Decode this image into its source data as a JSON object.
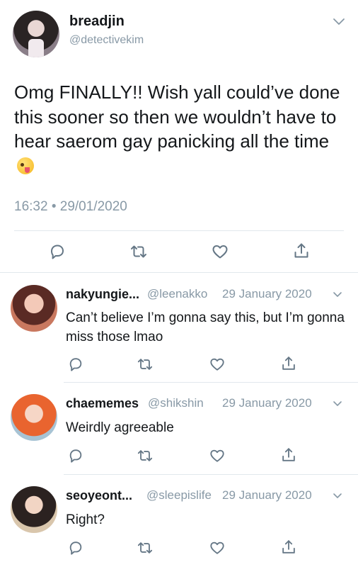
{
  "main_tweet": {
    "display_name": "breadjin",
    "handle": "@detectivekim",
    "text": "Omg FINALLY!! Wish yall could’ve done this sooner so then we wouldn’t have to hear saerom gay panicking all the time",
    "timestamp": "16:32 • 29/01/2020",
    "emoji": "zany-face-emoji"
  },
  "replies": [
    {
      "display_name": "nakyungie...",
      "handle": "@leenakko",
      "date": "29 January 2020",
      "text": "Can’t believe I’m gonna say this, but I’m gonna miss those lmao"
    },
    {
      "display_name": "chaememes",
      "handle": "@shikshin",
      "date": "29 January 2020",
      "text": "Weirdly agreeable"
    },
    {
      "display_name": "seoyeont...",
      "handle": "@sleepislife",
      "date": "29 January 2020",
      "text": "Right?"
    }
  ],
  "icons": [
    "reply-icon",
    "retweet-icon",
    "like-icon",
    "share-icon",
    "chevron-down-icon"
  ],
  "colors": {
    "text": "#14171a",
    "secondary": "#8899a6",
    "icon": "#657786",
    "divider": "#e1e8ed"
  }
}
